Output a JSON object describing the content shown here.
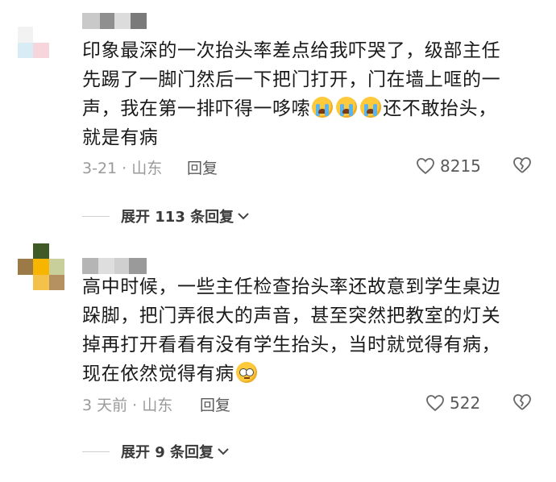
{
  "comments": [
    {
      "text_lines": [
        "印象最深的一次抬头率差点给我吓哭了，级部主任",
        "先踢了一脚门然后一下把门打开，门在墙上哐的一",
        "声，我在第一排吓得一哆嗦",
        "还不敢抬头，",
        "就是有病"
      ],
      "emojis": [
        "crying-emoji",
        "crying-emoji",
        "crying-emoji"
      ],
      "date": "3-21",
      "location": "山东",
      "reply_label": "回复",
      "likes": "8215",
      "expand_label": "展开 113 条回复"
    },
    {
      "text_lines": [
        "高中时候，一些主任检查抬头率还故意到学生桌边",
        "跺脚，把门弄很大的声音，甚至突然把教室的灯关",
        "掉再打开看看有没有学生抬头，当时就觉得有病，",
        "现在依然觉得有病"
      ],
      "emojis": [
        "thinking-emoji"
      ],
      "date": "3 天前",
      "location": "山东",
      "reply_label": "回复",
      "likes": "522",
      "expand_label": "展开 9 条回复"
    }
  ],
  "colors": {
    "text": "#1a1a1a",
    "meta": "#9a9a9a",
    "action": "#5a5a5a",
    "emoji": "#ffc93c"
  }
}
